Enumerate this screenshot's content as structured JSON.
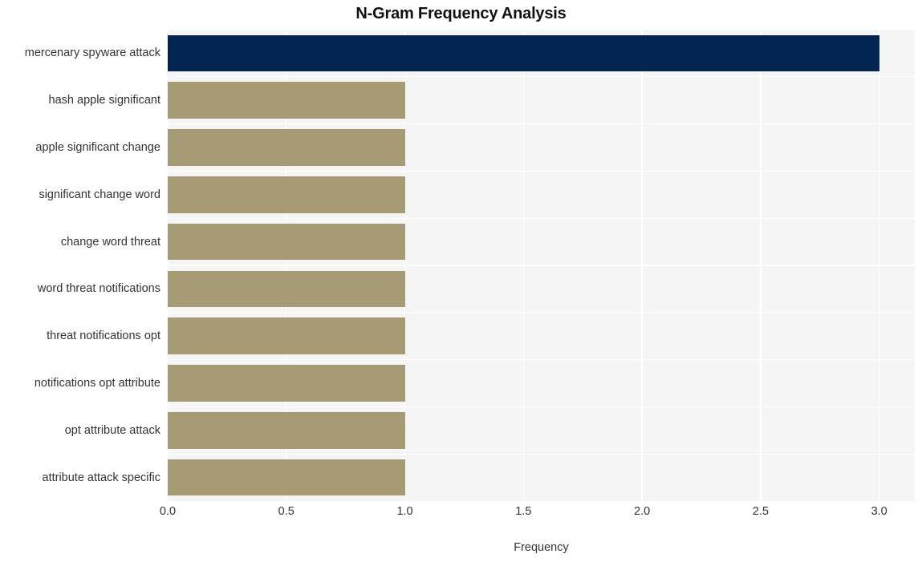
{
  "chart_data": {
    "type": "bar",
    "orientation": "horizontal",
    "title": "N-Gram Frequency Analysis",
    "xlabel": "Frequency",
    "ylabel": "",
    "categories": [
      "mercenary spyware attack",
      "hash apple significant",
      "apple significant change",
      "significant change word",
      "change word threat",
      "word threat notifications",
      "threat notifications opt",
      "notifications opt attribute",
      "opt attribute attack",
      "attribute attack specific"
    ],
    "values": [
      3,
      1,
      1,
      1,
      1,
      1,
      1,
      1,
      1,
      1
    ],
    "xlim": [
      0,
      3.15
    ],
    "xticks": [
      "0.0",
      "0.5",
      "1.0",
      "1.5",
      "2.0",
      "2.5",
      "3.0"
    ],
    "xtick_values": [
      0,
      0.5,
      1,
      1.5,
      2,
      2.5,
      3
    ],
    "grid": true,
    "legend": false,
    "bar_colors": [
      "#012450",
      "#a69b74",
      "#a69b74",
      "#a69b74",
      "#a69b74",
      "#a69b74",
      "#a69b74",
      "#a69b74",
      "#a69b74",
      "#a69b74"
    ],
    "highlight_color": "#012450",
    "base_color": "#a69b74",
    "plot_background": "#f5f5f6",
    "grid_color": "#ffffff",
    "figure_background": "#ffffff",
    "text_color": "#333333"
  }
}
